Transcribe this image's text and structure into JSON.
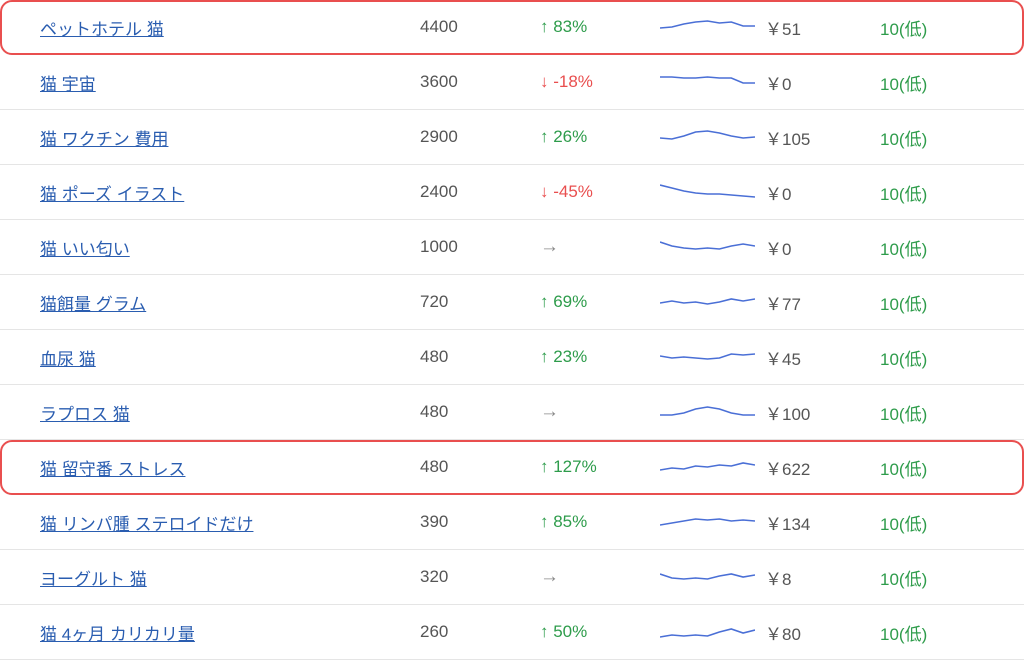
{
  "currency_prefix": "￥",
  "rows": [
    {
      "keyword": "ペットホテル 猫",
      "volume": "4400",
      "change_dir": "up",
      "change_text": "↑ 83%",
      "spark": [
        14,
        13,
        10,
        8,
        7,
        9,
        8,
        12,
        12
      ],
      "cpc": "51",
      "competition": "10(低)",
      "highlight": true
    },
    {
      "keyword": "猫 宇宙",
      "volume": "3600",
      "change_dir": "down",
      "change_text": "↓ -18%",
      "spark": [
        8,
        8,
        9,
        9,
        8,
        9,
        9,
        14,
        14
      ],
      "cpc": "0",
      "competition": "10(低)",
      "highlight": false
    },
    {
      "keyword": "猫 ワクチン 費用",
      "volume": "2900",
      "change_dir": "up",
      "change_text": "↑ 26%",
      "spark": [
        14,
        15,
        12,
        8,
        7,
        9,
        12,
        14,
        13
      ],
      "cpc": "105",
      "competition": "10(低)",
      "highlight": false
    },
    {
      "keyword": "猫 ポーズ イラスト",
      "volume": "2400",
      "change_dir": "down",
      "change_text": "↓ -45%",
      "spark": [
        6,
        9,
        12,
        14,
        15,
        15,
        16,
        17,
        18
      ],
      "cpc": "0",
      "competition": "10(低)",
      "highlight": false
    },
    {
      "keyword": "猫 いい匂い",
      "volume": "1000",
      "change_dir": "flat",
      "change_text": "→",
      "spark": [
        8,
        12,
        14,
        15,
        14,
        15,
        12,
        10,
        12
      ],
      "cpc": "0",
      "competition": "10(低)",
      "highlight": false
    },
    {
      "keyword": "猫餌量 グラム",
      "volume": "720",
      "change_dir": "up",
      "change_text": "↑ 69%",
      "spark": [
        14,
        12,
        14,
        13,
        15,
        13,
        10,
        12,
        10
      ],
      "cpc": "77",
      "competition": "10(低)",
      "highlight": false
    },
    {
      "keyword": "血尿 猫",
      "volume": "480",
      "change_dir": "up",
      "change_text": "↑ 23%",
      "spark": [
        12,
        14,
        13,
        14,
        15,
        14,
        10,
        11,
        10
      ],
      "cpc": "45",
      "competition": "10(低)",
      "highlight": false
    },
    {
      "keyword": "ラプロス 猫",
      "volume": "480",
      "change_dir": "flat",
      "change_text": "→",
      "spark": [
        16,
        16,
        14,
        10,
        8,
        10,
        14,
        16,
        16
      ],
      "cpc": "100",
      "competition": "10(低)",
      "highlight": false
    },
    {
      "keyword": "猫 留守番 ストレス",
      "volume": "480",
      "change_dir": "up",
      "change_text": "↑ 127%",
      "spark": [
        16,
        14,
        15,
        12,
        13,
        11,
        12,
        9,
        11
      ],
      "cpc": "622",
      "competition": "10(低)",
      "highlight": true
    },
    {
      "keyword": "猫 リンパ腫 ステロイドだけ",
      "volume": "390",
      "change_dir": "up",
      "change_text": "↑ 85%",
      "spark": [
        16,
        14,
        12,
        10,
        11,
        10,
        12,
        11,
        12
      ],
      "cpc": "134",
      "competition": "10(低)",
      "highlight": false
    },
    {
      "keyword": "ヨーグルト 猫",
      "volume": "320",
      "change_dir": "flat",
      "change_text": "→",
      "spark": [
        10,
        14,
        15,
        14,
        15,
        12,
        10,
        13,
        11
      ],
      "cpc": "8",
      "competition": "10(低)",
      "highlight": false
    },
    {
      "keyword": "猫 4ヶ月 カリカリ量",
      "volume": "260",
      "change_dir": "up",
      "change_text": "↑ 50%",
      "spark": [
        18,
        16,
        17,
        16,
        17,
        13,
        10,
        14,
        11
      ],
      "cpc": "80",
      "competition": "10(低)",
      "highlight": false
    }
  ]
}
